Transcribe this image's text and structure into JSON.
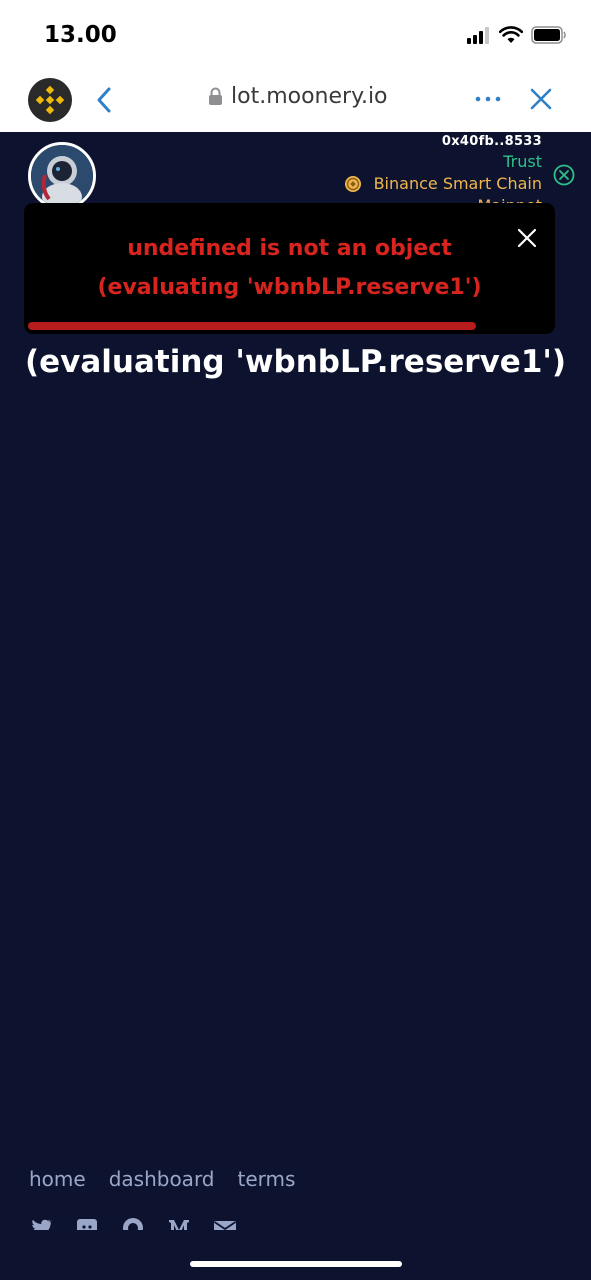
{
  "status_bar": {
    "time": "13.00",
    "icons": [
      "signal-icon",
      "wifi-icon",
      "battery-icon"
    ]
  },
  "browser": {
    "url": "lot.moonery.io",
    "icons": [
      "binance-logo-icon",
      "back-icon",
      "lock-icon",
      "more-icon",
      "close-icon"
    ],
    "accent_color": "#2f80c8"
  },
  "header": {
    "wallet_address": "0x40fb..8533",
    "wallet_name": "Trust",
    "network": "Binance Smart Chain",
    "network_type": "Mainnet",
    "wallet_color": "#2fc18b",
    "network_color": "#f0b64e"
  },
  "toast": {
    "line1": "undefined is not an object",
    "line2": "(evaluating 'wbnbLP.reserve1')",
    "text_color": "#d8241f",
    "progress": 0.85
  },
  "main": {
    "error_text": "(evaluating 'wbnbLP.reserve1')"
  },
  "footer": {
    "links": [
      {
        "label": "home"
      },
      {
        "label": "dashboard"
      },
      {
        "label": "terms"
      }
    ],
    "social_icons": [
      "twitter-icon",
      "discord-icon",
      "github-icon",
      "medium-icon",
      "mail-icon"
    ]
  },
  "colors": {
    "background": "#0d132e",
    "toast_bg": "#000000"
  }
}
